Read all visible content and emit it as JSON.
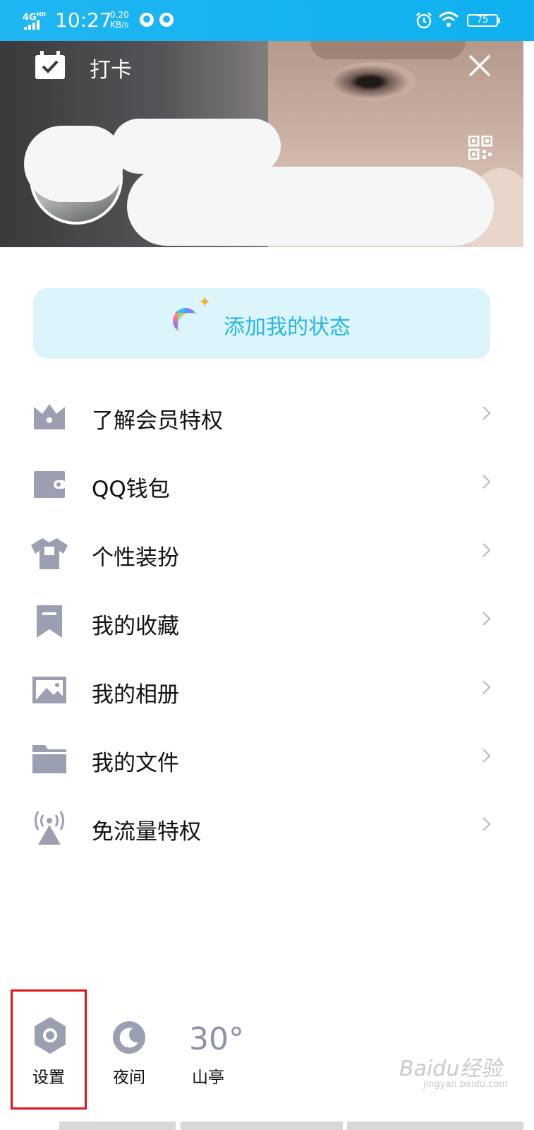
{
  "status_bar": {
    "network": "4G",
    "network_sup": "HD",
    "time": "10:27",
    "speed_value": "0.20",
    "speed_unit": "KB/s",
    "battery": "75",
    "icons": [
      "qq-icon",
      "qq-icon",
      "alarm-icon",
      "wifi-icon",
      "battery-icon"
    ]
  },
  "header": {
    "checkin_label": "打卡",
    "icons": [
      "calendar-check-icon",
      "close-icon",
      "qr-code-icon"
    ],
    "stars": "★★★"
  },
  "status_button": {
    "label": "添加我的状态",
    "icon": "status-ring-icon"
  },
  "menu": [
    {
      "label": "了解会员特权",
      "icon": "crown-icon"
    },
    {
      "label": "QQ钱包",
      "icon": "wallet-icon"
    },
    {
      "label": "个性装扮",
      "icon": "tshirt-icon"
    },
    {
      "label": "我的收藏",
      "icon": "bookmark-icon"
    },
    {
      "label": "我的相册",
      "icon": "photo-icon"
    },
    {
      "label": "我的文件",
      "icon": "folder-icon"
    },
    {
      "label": "免流量特权",
      "icon": "broadcast-icon"
    }
  ],
  "bottom": {
    "settings_label": "设置",
    "night_label": "夜间",
    "temperature": "30°",
    "location": "山亭"
  },
  "watermark": {
    "text": "Baidu经验",
    "sub": "jingyan.baidu.com"
  },
  "colors": {
    "status_bar": "#1fb6f3",
    "accent": "#25b7e4",
    "icon_gray": "#9aa0b1",
    "highlight": "#e1141a"
  }
}
